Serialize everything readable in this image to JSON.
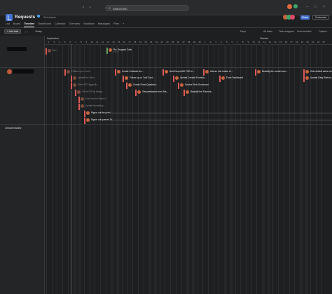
{
  "topbar": {
    "search_placeholder": "Search 800",
    "nav_back": "‹",
    "nav_fwd": "›",
    "window_controls": [
      "–",
      "□",
      "×"
    ]
  },
  "project": {
    "title": "Requests",
    "set_status": "Set status",
    "share_label": "Share",
    "customize_label": "Customize"
  },
  "tabs": [
    "List",
    "Board",
    "Timeline",
    "Dashboard",
    "Calendar",
    "Overview",
    "Workflow",
    "Messages",
    "Files",
    "+"
  ],
  "active_tab": "Timeline",
  "toolbar": {
    "add_task": "+ Add task",
    "today": "Today",
    "days_label": "Days",
    "all_tasks": "All tasks",
    "task_assignee": "Task assignee",
    "unscheduled": "Unscheduled",
    "options": "Options"
  },
  "timeline": {
    "months": [
      "September",
      "October"
    ],
    "days_sep": [
      "2",
      "3",
      "4",
      "5",
      "6",
      "7",
      "8",
      "9",
      "10",
      "11",
      "12",
      "13",
      "14",
      "15",
      "16",
      "17",
      "18",
      "19",
      "20",
      "21",
      "22",
      "23",
      "24",
      "25",
      "26",
      "27",
      "28",
      "29",
      "30"
    ],
    "days_oct": [
      "1",
      "2",
      "3",
      "4",
      "5",
      "6",
      "7",
      "8",
      "9",
      "10",
      "11",
      "12",
      "13",
      "14",
      "15",
      "16",
      "17",
      "18",
      "19",
      "20",
      "21",
      "22",
      "23"
    ]
  },
  "sections": {
    "unscheduled_label": "Unscheduled"
  },
  "tasks_section1": [
    {
      "title": "Re: Dropped Calls",
      "sub": "2 of 3",
      "status": "green"
    },
    {
      "title": "Dec",
      "sub": "",
      "status": "dim"
    }
  ],
  "tasks_section2": [
    {
      "title": "Follow up on Cont...",
      "sub": "",
      "status": "dim"
    },
    {
      "title": "Create Contacts via...",
      "sub": "",
      "status": "red"
    },
    {
      "title": "Add Europe/UK FCE to ...",
      "sub": "",
      "status": "red"
    },
    {
      "title": "Add an Info button to ...",
      "sub": "",
      "status": "red"
    },
    {
      "title": "Beautify the content sco...",
      "sub": "",
      "status": "red"
    },
    {
      "title": "Hide default sales ore...",
      "sub": "",
      "status": "red"
    },
    {
      "title": "Update the Ulmo...",
      "sub": "",
      "status": "dim"
    },
    {
      "title": "Follow up on 'Add Cont...",
      "sub": "",
      "status": "red"
    },
    {
      "title": "Update Contact Formula...",
      "sub": "",
      "status": "red"
    },
    {
      "title": "Form Dashboard",
      "sub": "",
      "status": "red"
    },
    {
      "title": "Update Daily Stats ta...",
      "sub": "",
      "status": "red"
    },
    {
      "title": "Fixed PS Trigger fix...",
      "sub": "",
      "status": "dim"
    },
    {
      "title": "Create Fixed Quadrant ...",
      "sub": "",
      "status": "red"
    },
    {
      "title": "Service Tech Scorecard",
      "sub": "",
      "status": "red"
    },
    {
      "title": "Fix the PS by testing",
      "sub": "",
      "status": "dim"
    },
    {
      "title": "Get permission from Sta...",
      "sub": "",
      "status": "red"
    },
    {
      "title": "Beautify the Formula...",
      "sub": "",
      "status": "red"
    },
    {
      "title": "Use Percent Status t...",
      "sub": "",
      "status": "dim"
    },
    {
      "title": "Update formatting ...",
      "sub": "",
      "status": "dim"
    },
    {
      "title": "Figure out the probl...",
      "sub": "",
      "status": "red"
    },
    {
      "title": "Figure out queued Dr...",
      "sub": "",
      "status": "red"
    }
  ]
}
